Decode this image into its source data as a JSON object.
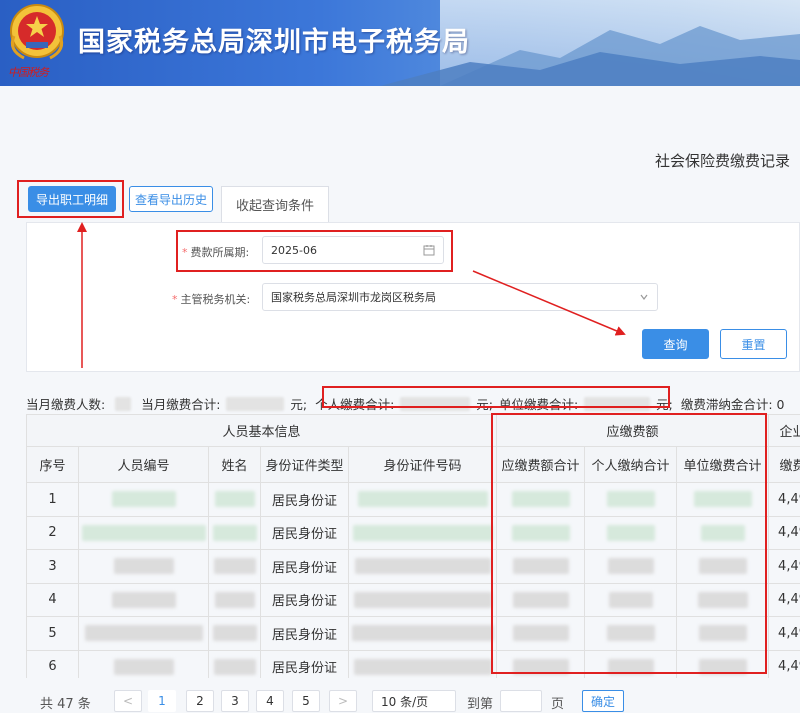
{
  "header": {
    "site_title": "国家税务总局深圳市电子税务局",
    "emblem_caption": "中国税务",
    "colors": {
      "banner": "#3c77d9",
      "title": "#ffffff"
    }
  },
  "page": {
    "record_title": "社会保险费缴费记录",
    "export_button": "导出职工明细",
    "history_button": "查看导出历史",
    "collapse_tab": "收起查询条件"
  },
  "form": {
    "period_label": "费款所属期:",
    "period_value": "2025-06",
    "agency_label": "主管税务机关:",
    "agency_value": "国家税务总局深圳市龙岗区税务局",
    "query_button": "查询",
    "reset_button": "重置"
  },
  "summary": {
    "headcount_label": "当月缴费人数:",
    "total_label": "当月缴费合计:",
    "total_unit": "元;",
    "personal_label": "个人缴费合计:",
    "personal_unit": "元;",
    "unit_label": "单位缴费合计:",
    "unit_unit": "元;",
    "late_label": "缴费滞纳金合计: 0"
  },
  "table": {
    "group_headers": [
      "人员基本信息",
      "应缴费额",
      "企业"
    ],
    "columns": [
      "序号",
      "人员编号",
      "姓名",
      "身份证件类型",
      "身份证件号码",
      "应缴费额合计",
      "个人缴纳合计",
      "单位缴费合计",
      "缴费"
    ],
    "rows": [
      {
        "index": "1",
        "id_type": "居民身份证",
        "extra": "4,49"
      },
      {
        "index": "2",
        "id_type": "居民身份证",
        "extra": "4,49"
      },
      {
        "index": "3",
        "id_type": "居民身份证",
        "extra": "4,49"
      },
      {
        "index": "4",
        "id_type": "居民身份证",
        "extra": "4,49"
      },
      {
        "index": "5",
        "id_type": "居民身份证",
        "extra": "4,49"
      },
      {
        "index": "6",
        "id_type": "居民身份证",
        "extra": "4,49"
      }
    ]
  },
  "pager": {
    "total_label": "共 47 条",
    "prev": "<",
    "pages": [
      "1",
      "2",
      "3",
      "4",
      "5"
    ],
    "next": ">",
    "page_size": "10 条/页",
    "goto_label": "到第",
    "page_unit": "页",
    "confirm": "确定"
  },
  "annotation_color": "#e02020"
}
